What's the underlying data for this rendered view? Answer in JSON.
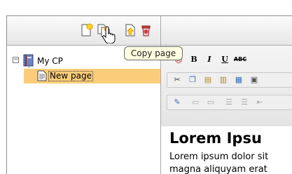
{
  "tree": {
    "root": {
      "label": "My CP",
      "toggle": "−"
    },
    "children": [
      {
        "label": "New page",
        "selected": true
      }
    ]
  },
  "tooltip": {
    "text": "Copy page"
  },
  "page_toolbar": {
    "icons": [
      "new-page-icon",
      "copy-page-icon",
      "paste-page-icon",
      "delete-page-icon"
    ]
  },
  "editor": {
    "toolbar": {
      "bold": "B",
      "italic": "I",
      "underline": "U",
      "strike": "ABC"
    },
    "heading": "Lorem Ipsu",
    "paragraph_lines": [
      "Lorem ipsum dolor sit",
      "magna aliquyam erat"
    ]
  },
  "colors": {
    "selection": "#fbcd7b",
    "tooltip_bg": "#ffffe1",
    "toolbar_bg": "#ececec"
  }
}
